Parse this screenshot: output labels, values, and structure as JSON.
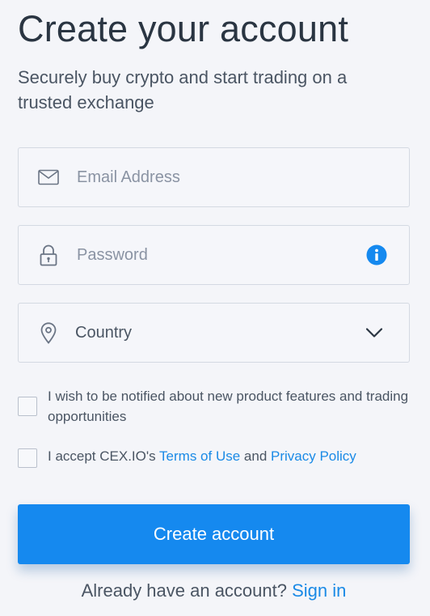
{
  "header": {
    "title": "Create your account",
    "subtitle": "Securely buy crypto and start trading on a trusted exchange"
  },
  "form": {
    "email": {
      "placeholder": "Email Address",
      "value": "",
      "icon": "envelope-icon"
    },
    "password": {
      "placeholder": "Password",
      "value": "",
      "icon": "lock-icon",
      "info_icon": "info-icon"
    },
    "country": {
      "value": "Country",
      "icon": "location-pin-icon",
      "chevron": "chevron-down-icon"
    }
  },
  "checkboxes": {
    "notify": {
      "label": "I wish to be notified about new product features and trading opportunities",
      "checked": false
    },
    "terms": {
      "prefix": "I accept CEX.IO's ",
      "terms_link": "Terms of Use",
      "middle": " and ",
      "privacy_link": "Privacy Policy",
      "checked": false
    }
  },
  "submit": {
    "label": "Create account"
  },
  "footer": {
    "text": "Already have an account? ",
    "link": "Sign in"
  },
  "colors": {
    "accent": "#1589ef",
    "link": "#1a8ae6",
    "background": "#f4f5f9",
    "border": "#d4d9e2",
    "text": "#2a3542"
  }
}
